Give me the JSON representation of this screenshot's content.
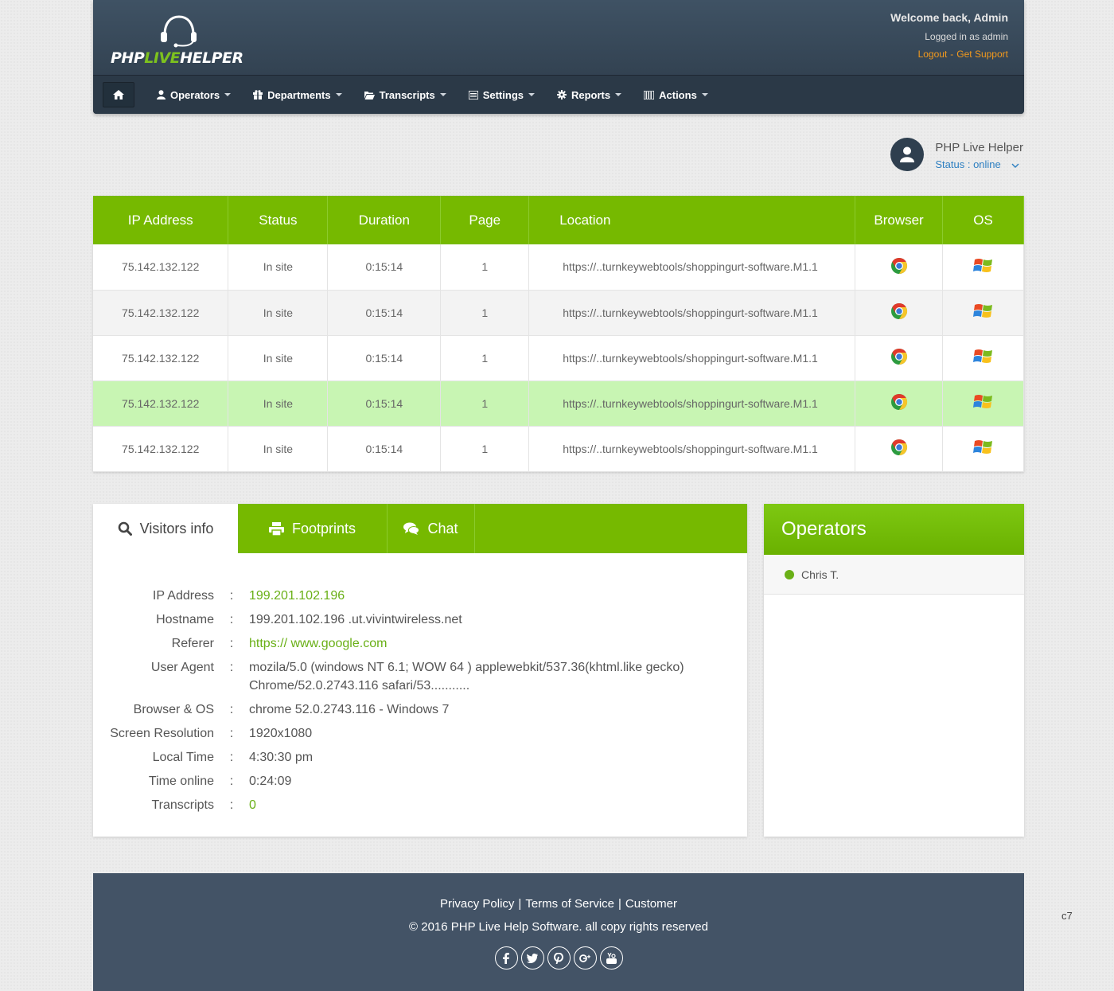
{
  "brand": {
    "word_php": "PHP",
    "word_live": "LIVE",
    "word_helper": "HELPER"
  },
  "header": {
    "welcome": "Welcome back, Admin",
    "logged_in": "Logged in as admin",
    "logout": "Logout",
    "separator": "-",
    "support": "Get Support"
  },
  "nav": {
    "items": [
      {
        "label": "Operators",
        "icon": "user-icon"
      },
      {
        "label": "Departments",
        "icon": "gift-icon"
      },
      {
        "label": "Transcripts",
        "icon": "folder-open-icon"
      },
      {
        "label": "Settings",
        "icon": "list-icon"
      },
      {
        "label": "Reports",
        "icon": "gear-icon"
      },
      {
        "label": "Actions",
        "icon": "columns-icon"
      }
    ]
  },
  "profile": {
    "name": "PHP Live Helper",
    "status": "Status : online"
  },
  "visitors_table": {
    "columns": [
      "IP Address",
      "Status",
      "Duration",
      "Page",
      "Location",
      "Browser",
      "OS"
    ],
    "rows": [
      {
        "ip": "75.142.132.122",
        "status": "In site",
        "duration": "0:15:14",
        "page": "1",
        "location": "https://..turnkeywebtools/shoppingurt-software.M1.1",
        "browser": "chrome-icon",
        "os": "windows-icon"
      },
      {
        "ip": "75.142.132.122",
        "status": "In site",
        "duration": "0:15:14",
        "page": "1",
        "location": "https://..turnkeywebtools/shoppingurt-software.M1.1",
        "browser": "chrome-icon",
        "os": "windows-icon"
      },
      {
        "ip": "75.142.132.122",
        "status": "In site",
        "duration": "0:15:14",
        "page": "1",
        "location": "https://..turnkeywebtools/shoppingurt-software.M1.1",
        "browser": "chrome-icon",
        "os": "windows-icon"
      },
      {
        "ip": "75.142.132.122",
        "status": "In site",
        "duration": "0:15:14",
        "page": "1",
        "location": "https://..turnkeywebtools/shoppingurt-software.M1.1",
        "browser": "chrome-icon",
        "os": "windows-icon"
      },
      {
        "ip": "75.142.132.122",
        "status": "In site",
        "duration": "0:15:14",
        "page": "1",
        "location": "https://..turnkeywebtools/shoppingurt-software.M1.1",
        "browser": "chrome-icon",
        "os": "windows-icon"
      }
    ]
  },
  "visitor_tabs": [
    "Visitors info",
    "Footprints",
    "Chat"
  ],
  "visitor_info": {
    "rows": [
      {
        "label": "IP Address",
        "value": "199.201.102.196"
      },
      {
        "label": "Hostname",
        "value": "199.201.102.196 .ut.vivintwireless.net"
      },
      {
        "label": "Referer",
        "value": "https:// www.google.com"
      },
      {
        "label": "User Agent",
        "value": "mozila/5.0 (windows NT 6.1; WOW 64 ) applewebkit/537.36(khtml.like gecko) Chrome/52.0.2743.116 safari/53..........."
      },
      {
        "label": "Browser & OS",
        "value": "chrome 52.0.2743.116 - Windows 7"
      },
      {
        "label": "Screen Resolution",
        "value": "1920x1080"
      },
      {
        "label": "Local Time",
        "value": "4:30:30 pm"
      },
      {
        "label": "Time online",
        "value": "0:24:09"
      },
      {
        "label": "Transcripts",
        "value": "0"
      }
    ],
    "colon": ":"
  },
  "operators": {
    "title": "Operators",
    "list": [
      "Chris T."
    ]
  },
  "footer": {
    "links": [
      "Privacy Policy",
      "Terms of Service",
      "Customer"
    ],
    "pipe": "|",
    "copyright": "© 2016 PHP Live Help Software. all copy rights reserved",
    "socials": [
      "facebook-icon",
      "twitter-icon",
      "pinterest-icon",
      "google-plus-icon",
      "youtube-icon"
    ]
  },
  "side_code": "c7",
  "colors": {
    "accent_green": "#76b900",
    "header_dark": "#2b3947",
    "link_orange": "#f39a1d",
    "footer_bg": "#435366"
  }
}
